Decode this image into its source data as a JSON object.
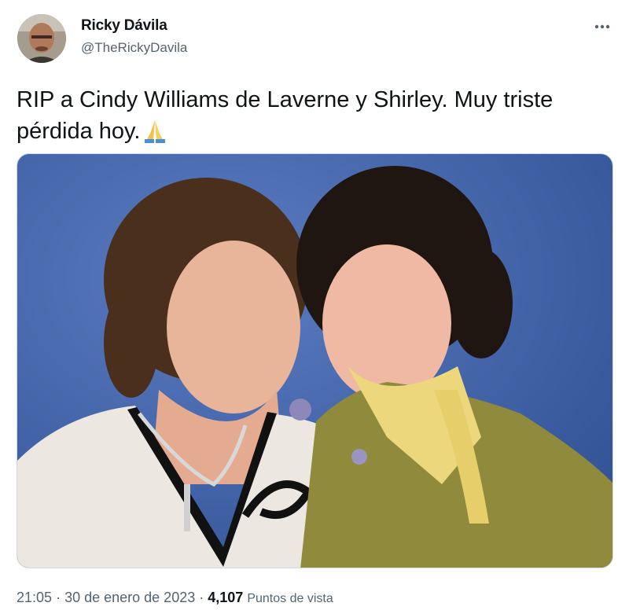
{
  "author": {
    "name": "Ricky Dávila",
    "handle": "@TheRickyDavila"
  },
  "tweet": {
    "text": "RIP a Cindy Williams de Laverne y Shirley. Muy triste pérdida hoy.",
    "emoji_icon": "folded-hands-icon"
  },
  "media": {
    "description_icon": "photo"
  },
  "meta": {
    "time": "21:05",
    "separator": "·",
    "date": "30 de enero de 2023",
    "views_count": "4,107",
    "views_label": "Puntos de vista"
  },
  "icons": {
    "more": "more-icon"
  },
  "colors": {
    "text": "#0f1419",
    "secondary": "#536471",
    "photo_background": "#3f63a8"
  }
}
